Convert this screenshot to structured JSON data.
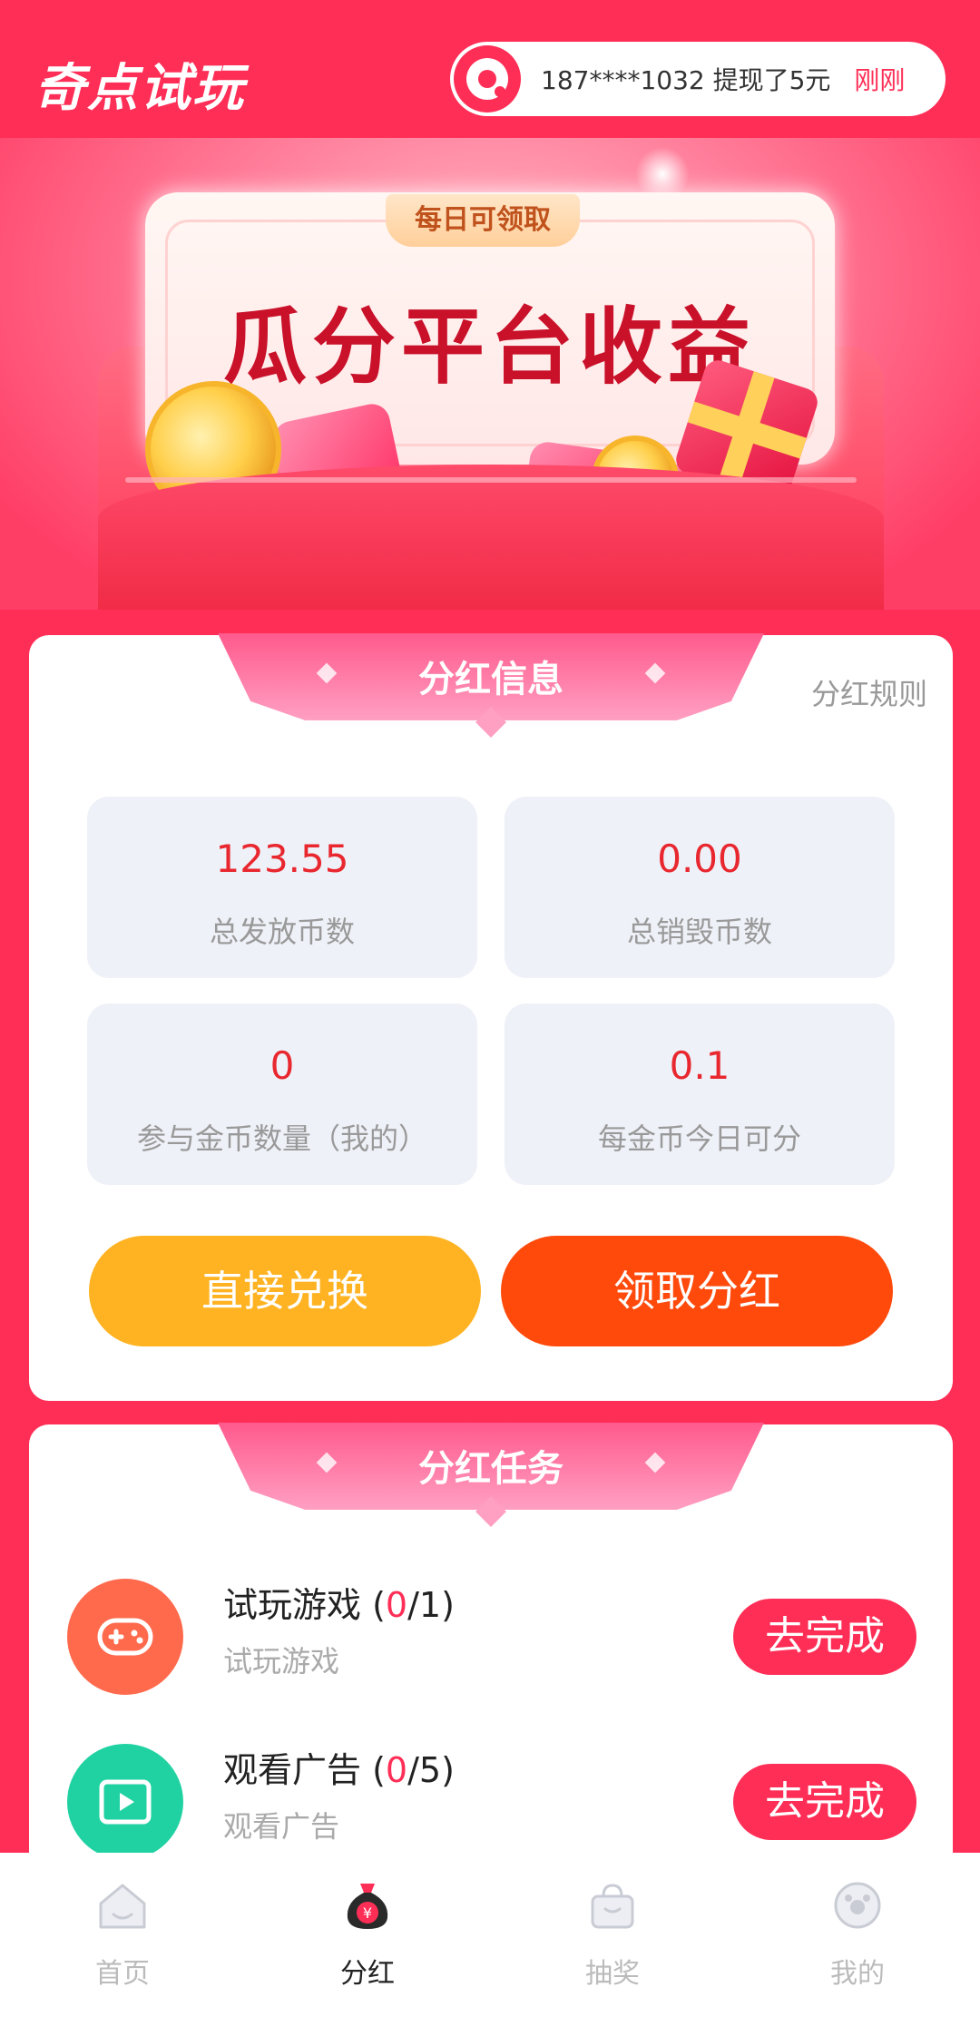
{
  "header": {
    "app_title": "奇点试玩",
    "notice_text": "187****1032 提现了5元",
    "notice_time": "刚刚"
  },
  "banner": {
    "tag": "每日可领取",
    "title": "瓜分平台收益"
  },
  "dividend_info": {
    "section_title": "分红信息",
    "rules_link": "分红规则",
    "stats": [
      {
        "value": "123.55",
        "label": "总发放币数"
      },
      {
        "value": "0.00",
        "label": "总销毁币数"
      },
      {
        "value": "0",
        "label": "参与金币数量（我的）"
      },
      {
        "value": "0.1",
        "label": "每金币今日可分"
      }
    ],
    "exchange_button": "直接兑换",
    "claim_button": "领取分红"
  },
  "dividend_tasks": {
    "section_title": "分红任务",
    "tasks": [
      {
        "name": "试玩游戏",
        "progress_open": " (",
        "current": "0",
        "total": "/1)",
        "subtitle": "试玩游戏",
        "button": "去完成",
        "icon": "gamepad-icon"
      },
      {
        "name": "观看广告",
        "progress_open": " (",
        "current": "0",
        "total": "/5)",
        "subtitle": "观看广告",
        "button": "去完成",
        "icon": "video-play-icon"
      }
    ]
  },
  "tabbar": {
    "items": [
      {
        "label": "首页",
        "icon": "home-icon",
        "active": false
      },
      {
        "label": "分红",
        "icon": "money-bag-icon",
        "active": true
      },
      {
        "label": "抽奖",
        "icon": "shopping-bag-icon",
        "active": false
      },
      {
        "label": "我的",
        "icon": "profile-face-icon",
        "active": false
      }
    ]
  },
  "colors": {
    "brand": "#ff2e56",
    "value_red": "#e8272f",
    "exchange_yellow": "#ffb322",
    "claim_orange": "#ff4a0c",
    "stat_bg": "#eff1f8"
  }
}
